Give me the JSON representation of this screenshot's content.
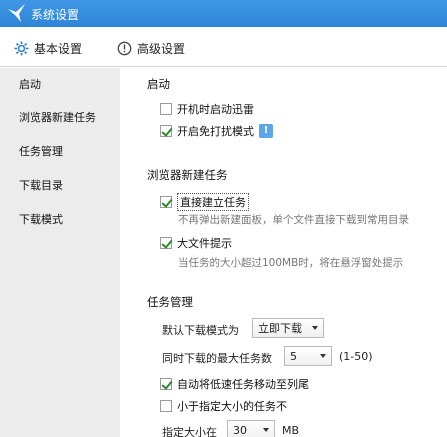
{
  "window": {
    "title": "系统设置"
  },
  "tabs": [
    {
      "label": "基本设置"
    },
    {
      "label": "高级设置"
    }
  ],
  "sidebar": {
    "items": [
      {
        "label": "启动"
      },
      {
        "label": "浏览器新建任务"
      },
      {
        "label": "任务管理"
      },
      {
        "label": "下载目录"
      },
      {
        "label": "下载模式"
      }
    ]
  },
  "startup": {
    "title": "启动",
    "opt_autostart": {
      "label": "开机时启动迅雷",
      "checked": false
    },
    "opt_no_disturb": {
      "label": "开启免打扰模式",
      "checked": true
    }
  },
  "browser_task": {
    "title": "浏览器新建任务",
    "opt_direct": {
      "label": "直接建立任务",
      "checked": true,
      "desc": "不再弹出新建面板，单个文件直接下载到常用目录"
    },
    "opt_big_file": {
      "label": "大文件提示",
      "checked": true,
      "desc": "当任务的大小超过100MB时，将在悬浮窗处提示"
    }
  },
  "task_mgmt": {
    "title": "任务管理",
    "default_mode_label": "默认下载模式为",
    "default_mode_value": "立即下载",
    "max_tasks_label": "同时下载的最大任务数",
    "max_tasks_value": "5",
    "max_tasks_range": "(1-50)",
    "opt_move_slow": {
      "label": "自动将低速任务移动至列尾",
      "checked": true
    },
    "opt_small": {
      "label": "小于指定大小的任务不",
      "checked": false
    },
    "size_label": "指定大小在",
    "size_value": "30",
    "size_unit": "MB"
  }
}
